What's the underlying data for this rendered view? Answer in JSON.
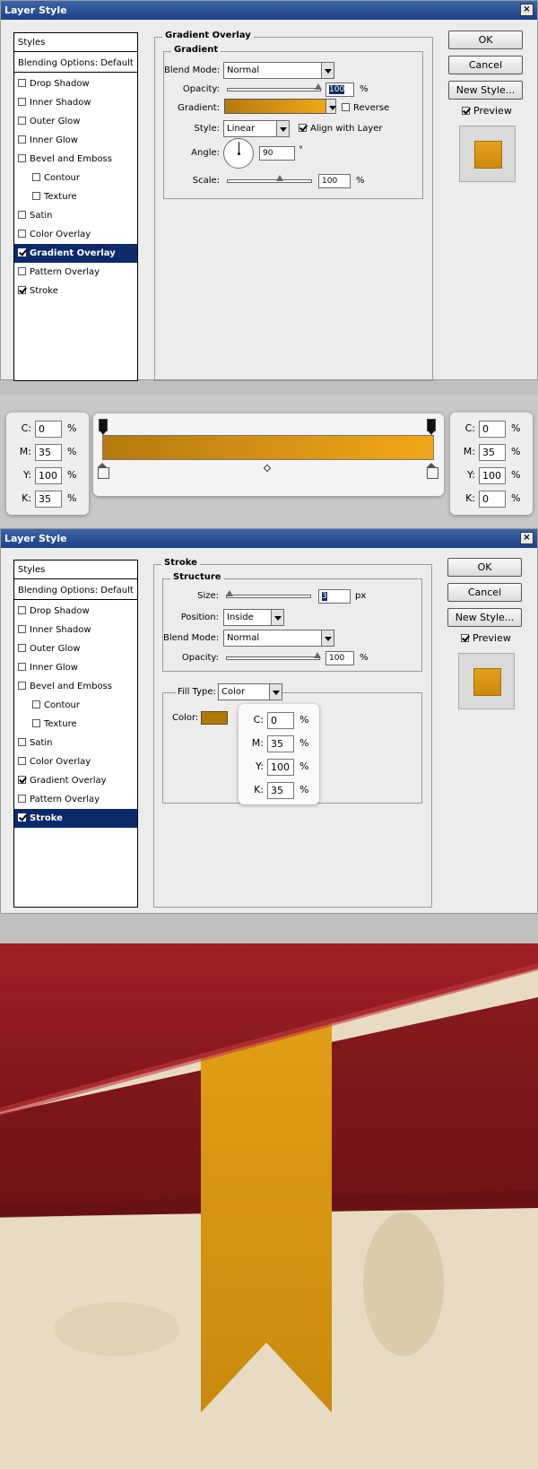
{
  "window1": {
    "title": "Layer Style",
    "close": "×",
    "styles_header": "Styles",
    "blending": "Blending Options: Default",
    "items": [
      {
        "label": "Drop Shadow",
        "checked": false,
        "sub": false
      },
      {
        "label": "Inner Shadow",
        "checked": false,
        "sub": false
      },
      {
        "label": "Outer Glow",
        "checked": false,
        "sub": false
      },
      {
        "label": "Inner Glow",
        "checked": false,
        "sub": false
      },
      {
        "label": "Bevel and Emboss",
        "checked": false,
        "sub": false
      },
      {
        "label": "Contour",
        "checked": false,
        "sub": true
      },
      {
        "label": "Texture",
        "checked": false,
        "sub": true
      },
      {
        "label": "Satin",
        "checked": false,
        "sub": false
      },
      {
        "label": "Color Overlay",
        "checked": false,
        "sub": false
      },
      {
        "label": "Gradient Overlay",
        "checked": true,
        "sub": false,
        "selected": true
      },
      {
        "label": "Pattern Overlay",
        "checked": false,
        "sub": false
      },
      {
        "label": "Stroke",
        "checked": true,
        "sub": false
      }
    ],
    "panel_title": "Gradient Overlay",
    "group_title": "Gradient",
    "blend_mode_label": "Blend Mode:",
    "blend_mode": "Normal",
    "opacity_label": "Opacity:",
    "opacity": "100",
    "percent": "%",
    "gradient_label": "Gradient:",
    "reverse_label": "Reverse",
    "style_label": "Style:",
    "style": "Linear",
    "align_label": "Align with Layer",
    "angle_label": "Angle:",
    "angle": "90",
    "degree": "°",
    "scale_label": "Scale:",
    "scale": "100",
    "buttons": {
      "ok": "OK",
      "cancel": "Cancel",
      "new_style": "New Style..."
    },
    "preview_label": "Preview"
  },
  "gradient_editor": {
    "left": {
      "c_label": "C:",
      "c": "0",
      "m_label": "M:",
      "m": "35",
      "y_label": "Y:",
      "y": "100",
      "k_label": "K:",
      "k": "35",
      "pct": "%"
    },
    "right": {
      "c_label": "C:",
      "c": "0",
      "m_label": "M:",
      "m": "35",
      "y_label": "Y:",
      "y": "100",
      "k_label": "K:",
      "k": "0",
      "pct": "%"
    }
  },
  "window2": {
    "title": "Layer Style",
    "close": "×",
    "styles_header": "Styles",
    "blending": "Blending Options: Default",
    "items": [
      {
        "label": "Drop Shadow",
        "checked": false,
        "sub": false
      },
      {
        "label": "Inner Shadow",
        "checked": false,
        "sub": false
      },
      {
        "label": "Outer Glow",
        "checked": false,
        "sub": false
      },
      {
        "label": "Inner Glow",
        "checked": false,
        "sub": false
      },
      {
        "label": "Bevel and Emboss",
        "checked": false,
        "sub": false
      },
      {
        "label": "Contour",
        "checked": false,
        "sub": true
      },
      {
        "label": "Texture",
        "checked": false,
        "sub": true
      },
      {
        "label": "Satin",
        "checked": false,
        "sub": false
      },
      {
        "label": "Color Overlay",
        "checked": false,
        "sub": false
      },
      {
        "label": "Gradient Overlay",
        "checked": true,
        "sub": false
      },
      {
        "label": "Pattern Overlay",
        "checked": false,
        "sub": false
      },
      {
        "label": "Stroke",
        "checked": true,
        "sub": false,
        "selected": true
      }
    ],
    "panel_title": "Stroke",
    "group_title": "Structure",
    "size_label": "Size:",
    "size": "3",
    "px": "px",
    "position_label": "Position:",
    "position": "Inside",
    "blend_mode_label": "Blend Mode:",
    "blend_mode": "Normal",
    "opacity_label": "Opacity:",
    "opacity": "100",
    "percent": "%",
    "fill_type_label": "Fill Type:",
    "fill_type": "Color",
    "color_label": "Color:",
    "cmyk": {
      "c_label": "C:",
      "c": "0",
      "m_label": "M:",
      "m": "35",
      "y_label": "Y:",
      "y": "100",
      "k_label": "K:",
      "k": "35",
      "pct": "%"
    },
    "buttons": {
      "ok": "OK",
      "cancel": "Cancel",
      "new_style": "New Style..."
    },
    "preview_label": "Preview"
  },
  "colors": {
    "gradient_dark": "#b57a0e",
    "gradient_light": "#f2a719",
    "stroke_color": "#b3780c",
    "ribbon_red": "#8d1a1e",
    "ribbon_gold": "#e09a14",
    "paper": "#e7dcc3"
  }
}
